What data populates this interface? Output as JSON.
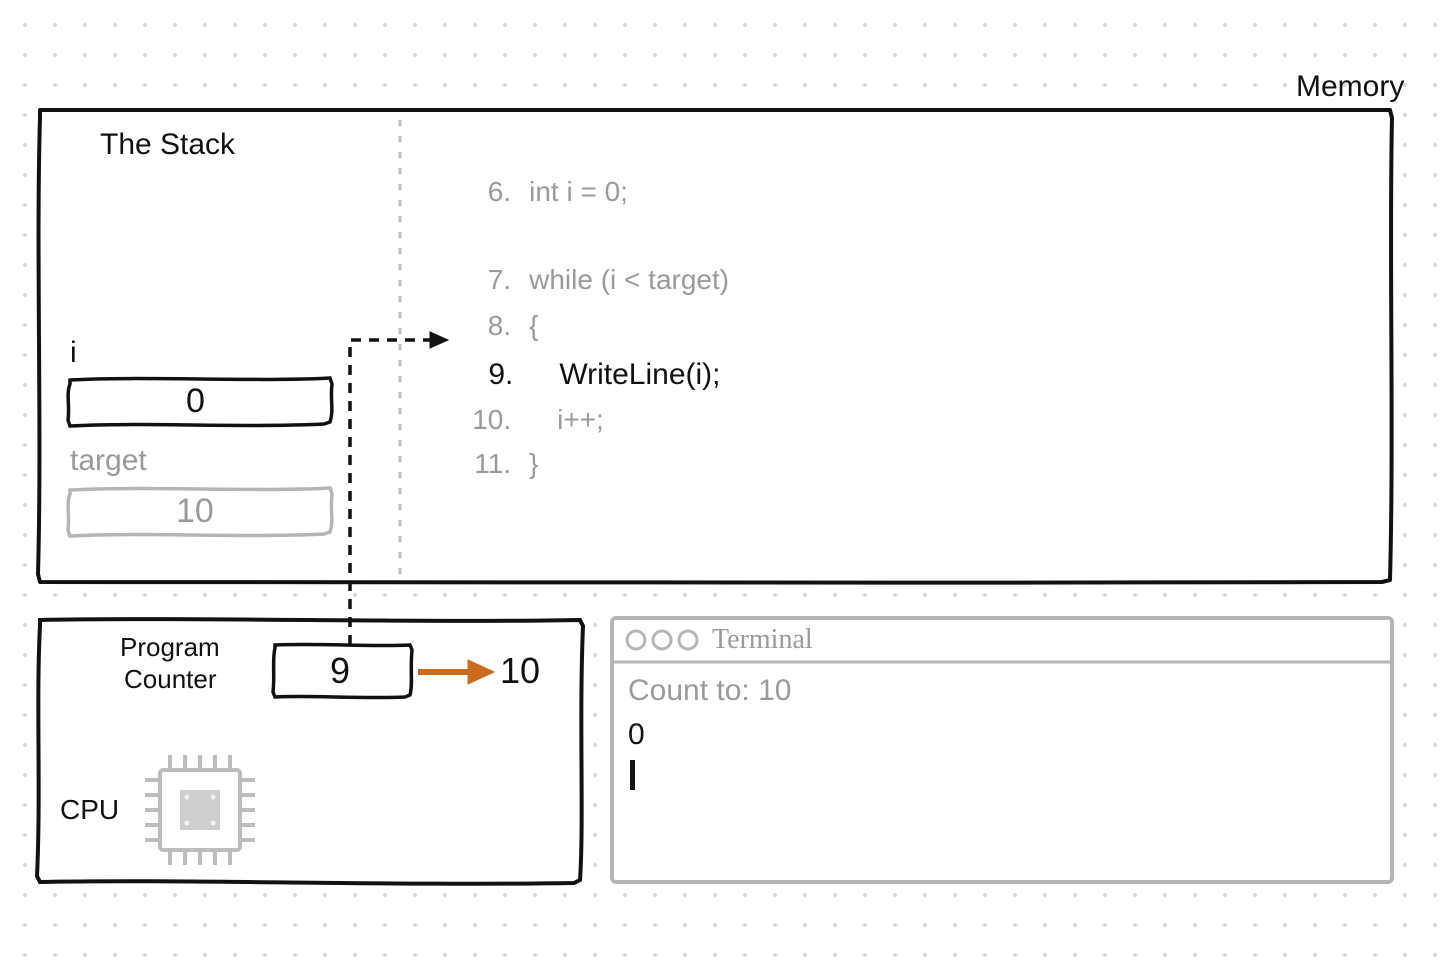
{
  "memory": {
    "title": "Memory"
  },
  "stack": {
    "title": "The Stack",
    "vars": [
      {
        "name": "i",
        "value": "0",
        "active": true
      },
      {
        "name": "target",
        "value": "10",
        "active": false
      }
    ]
  },
  "code": {
    "lines": [
      {
        "n": "6.",
        "text": "int i = 0;",
        "active": false,
        "indent": 0
      },
      {
        "n": "",
        "text": "",
        "active": false,
        "indent": 0
      },
      {
        "n": "7.",
        "text": "while (i < target)",
        "active": false,
        "indent": 0
      },
      {
        "n": "8.",
        "text": "{",
        "active": false,
        "indent": 0
      },
      {
        "n": "9.",
        "text": "WriteLine(i);",
        "active": true,
        "indent": 1
      },
      {
        "n": "10.",
        "text": "i++;",
        "active": false,
        "indent": 1
      },
      {
        "n": "11.",
        "text": "}",
        "active": false,
        "indent": 0
      }
    ]
  },
  "cpu": {
    "title": "CPU",
    "pc_label_line1": "Program",
    "pc_label_line2": "Counter",
    "pc_value": "9",
    "pc_next": "10"
  },
  "terminal": {
    "title": "Terminal",
    "prompt": "Count to: 10",
    "output": [
      "0"
    ]
  },
  "colors": {
    "ink": "#111111",
    "faded": "#9a9a9a",
    "accent": "#c96a1f"
  }
}
